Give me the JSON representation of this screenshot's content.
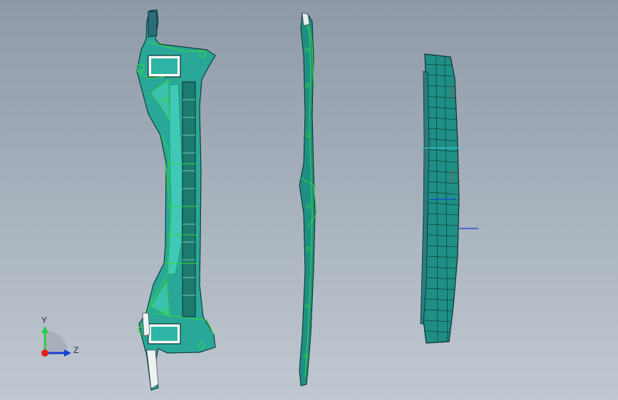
{
  "viewport": {
    "background_top": "#8e99a8",
    "background_bottom": "#c0c8d1"
  },
  "parts": [
    {
      "name": "part-front-view",
      "primary_color": "#2a9d8f",
      "edge_color": "#33cc33"
    },
    {
      "name": "part-side-view",
      "primary_color": "#2a9d8f",
      "edge_color": "#33cc33"
    },
    {
      "name": "part-rear-view",
      "primary_color": "#1f8f85",
      "edge_color": "#0b2f2d"
    }
  ],
  "axis_triad": {
    "y_label": "Y",
    "z_label": "Z",
    "y_color": "#2ecc40",
    "z_color": "#1a3fd6",
    "x_color": "#e0201b"
  }
}
